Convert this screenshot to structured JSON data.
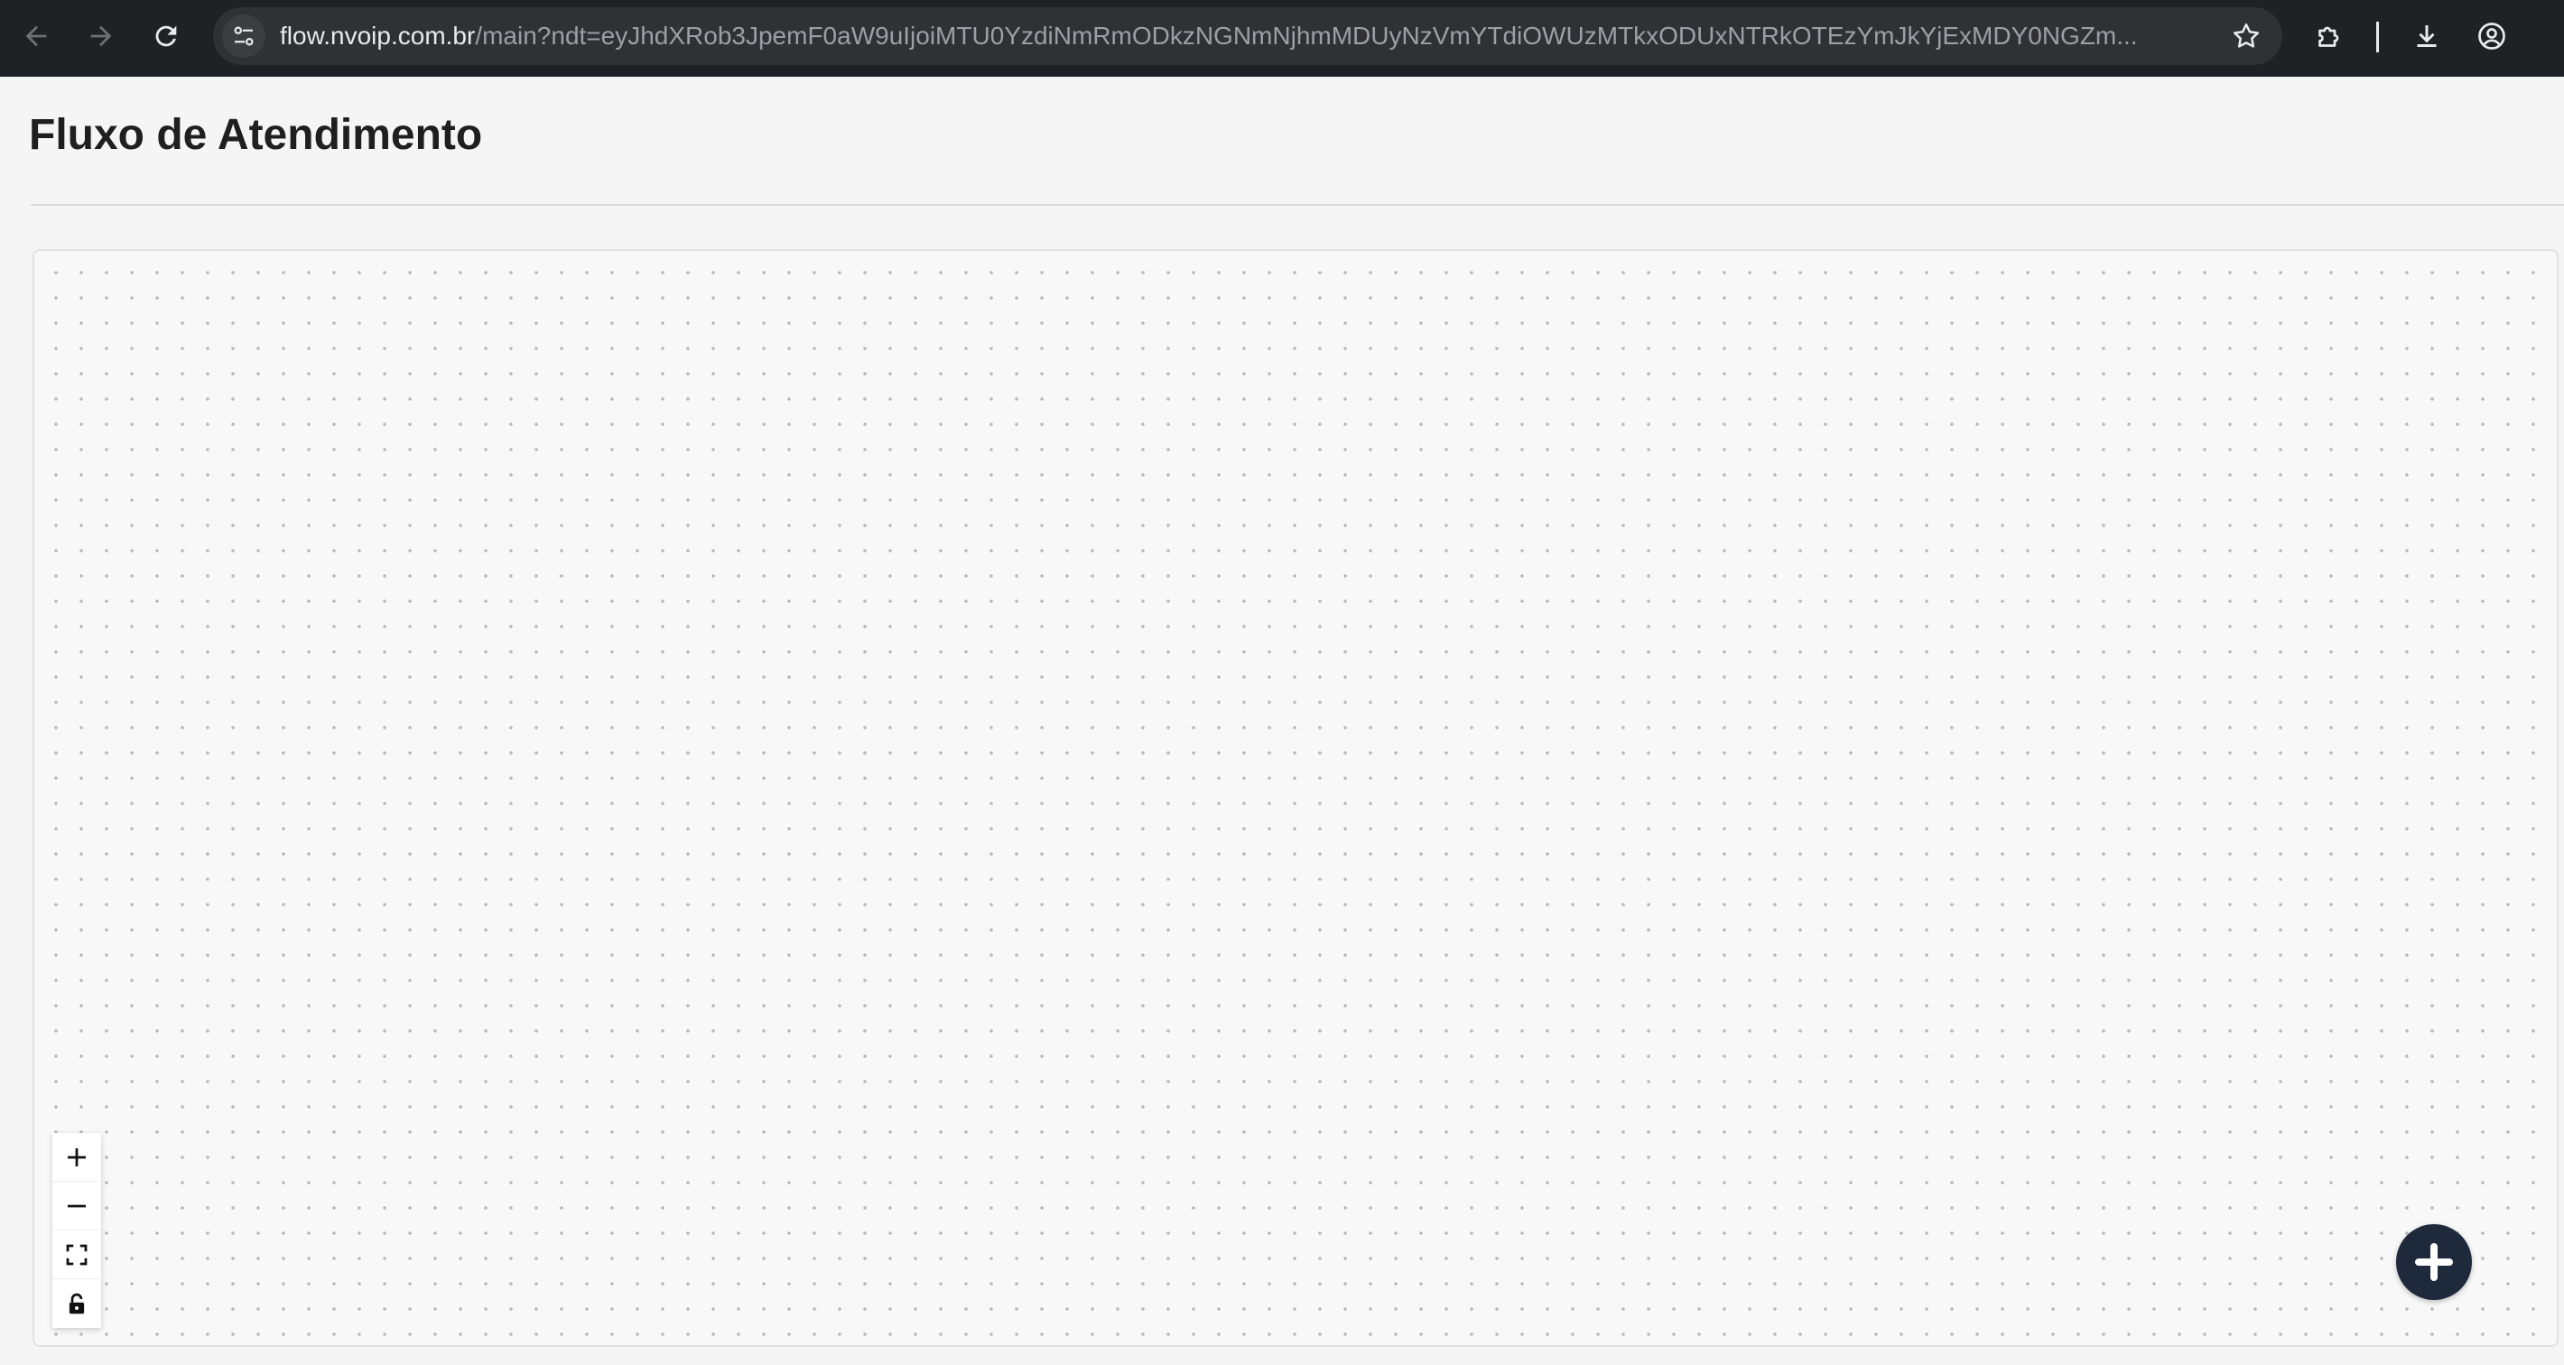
{
  "browser": {
    "url_host": "flow.nvoip.com.br",
    "url_path": "/main?ndt=eyJhdXRob3JpemF0aW9uIjoiMTU0YzdiNmRmODkzNGNmNjhmMDUyNzVmYTdiOWUzMTkxODUxNTRkOTEzYmJkYjExMDY0NGZm...",
    "icons": {
      "back": "arrow-back-icon",
      "forward": "arrow-forward-icon",
      "reload": "reload-icon",
      "site_info": "tune-icon",
      "bookmark": "star-icon",
      "extensions": "puzzle-icon",
      "downloads": "download-icon",
      "profile": "account-icon"
    }
  },
  "page": {
    "title": "Fluxo de Atendimento"
  },
  "canvas_controls": {
    "zoom_in": "plus-icon",
    "zoom_out": "minus-icon",
    "fit_view": "fit-view-icon",
    "lock": "lock-icon"
  },
  "fab": {
    "icon": "plus-icon",
    "color": "#1e293b"
  },
  "colors": {
    "chrome_bg": "#202124",
    "page_bg": "#f5f5f5",
    "title": "#1f1f1f"
  }
}
